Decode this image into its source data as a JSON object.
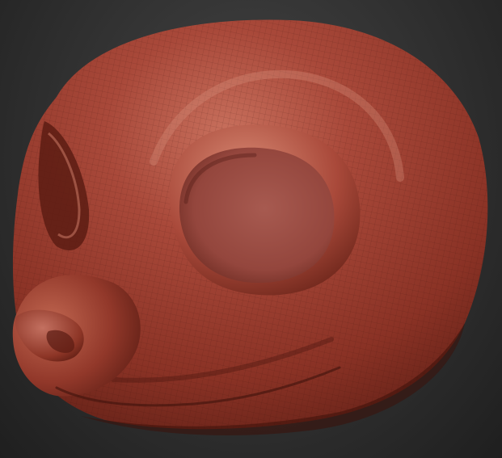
{
  "canvas": {
    "subject": "sculpt-head-model",
    "material_colors": {
      "base": "#8e3528",
      "highlight": "#c8705d",
      "shadow": "#4a1710",
      "eye_socket": "#9a4d44",
      "background_top": "#454545",
      "background_bottom": "#1f1f1f"
    }
  }
}
